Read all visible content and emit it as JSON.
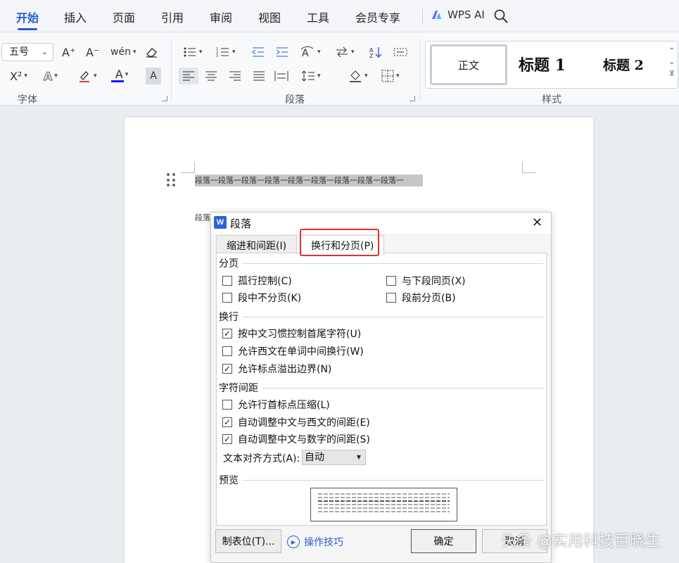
{
  "menu": {
    "tabs": [
      {
        "label": "开始",
        "active": true
      },
      {
        "label": "插入"
      },
      {
        "label": "页面"
      },
      {
        "label": "引用"
      },
      {
        "label": "审阅"
      },
      {
        "label": "视图"
      },
      {
        "label": "工具"
      },
      {
        "label": "会员专享"
      }
    ],
    "ai_label": "WPS AI"
  },
  "ribbon": {
    "font_group": {
      "label": "字体",
      "font_size": "五号",
      "grow": "A⁺",
      "shrink": "A⁻",
      "phonetic": "wén",
      "superscript": "X²",
      "highlight": "A",
      "font_color": "A",
      "char_shading": "A",
      "font_color_hex": "#1a1aff"
    },
    "paragraph_group": {
      "label": "段落"
    },
    "styles_group": {
      "label": "样式",
      "normal": "正文",
      "heading1": "标题 1",
      "heading2": "标题 2"
    }
  },
  "document": {
    "selected_line": "段落一段落一段落一段落一段落一段落一段落一段落一段落一",
    "fragment": "段落"
  },
  "dialog": {
    "title": "段落",
    "logo": "W",
    "tabs": [
      "缩进和间距(I)",
      "换行和分页(P)"
    ],
    "active_tab": "换行和分页(P)",
    "sections": {
      "pagination": {
        "title": "分页",
        "options": [
          {
            "label": "孤行控制(C)",
            "checked": false
          },
          {
            "label": "与下段同页(X)",
            "checked": false
          },
          {
            "label": "段中不分页(K)",
            "checked": false
          },
          {
            "label": "段前分页(B)",
            "checked": false
          }
        ]
      },
      "line_break": {
        "title": "换行",
        "options": [
          {
            "label": "按中文习惯控制首尾字符(U)",
            "checked": true
          },
          {
            "label": "允许西文在单词中间换行(W)",
            "checked": false
          },
          {
            "label": "允许标点溢出边界(N)",
            "checked": true
          }
        ]
      },
      "char_spacing": {
        "title": "字符间距",
        "options": [
          {
            "label": "允许行首标点压缩(L)",
            "checked": false
          },
          {
            "label": "自动调整中文与西文的间距(E)",
            "checked": true
          },
          {
            "label": "自动调整中文与数字的间距(S)",
            "checked": true
          }
        ]
      },
      "text_align": {
        "label": "文本对齐方式(A):",
        "value": "自动"
      },
      "preview": {
        "title": "预览"
      }
    },
    "buttons": {
      "tabs": "制表位(T)...",
      "tips": "操作技巧",
      "ok": "确定",
      "cancel": "取消"
    }
  },
  "watermark": "头条 @实用科技百晓生"
}
